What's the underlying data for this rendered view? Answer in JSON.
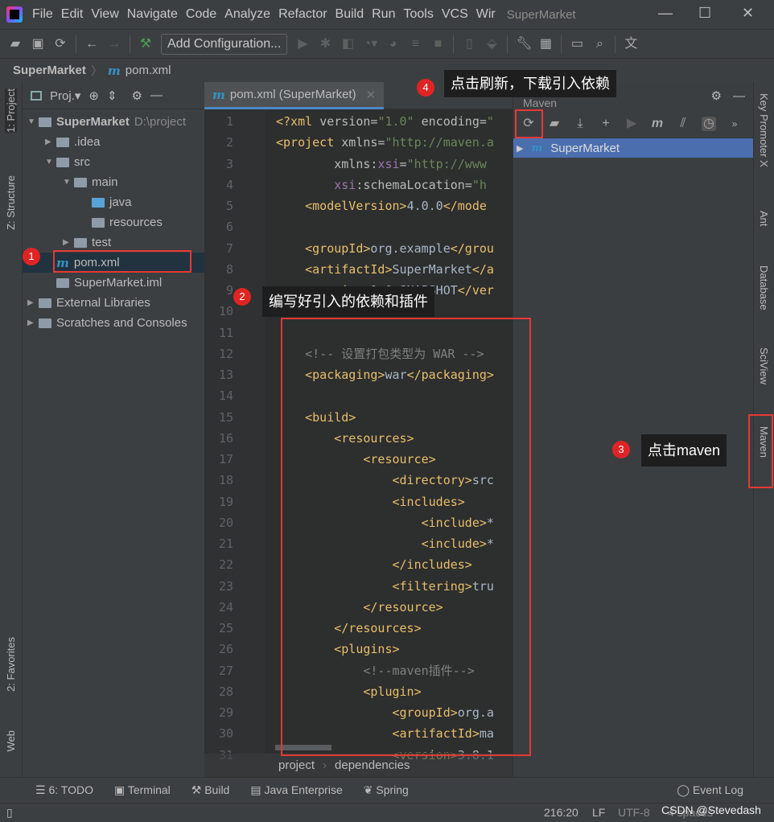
{
  "window": {
    "title": "SuperMarket",
    "menu": [
      "File",
      "Edit",
      "View",
      "Navigate",
      "Code",
      "Analyze",
      "Refactor",
      "Build",
      "Run",
      "Tools",
      "VCS",
      "Wir"
    ]
  },
  "toolbar": {
    "add_configuration": "Add Configuration..."
  },
  "breadcrumb": {
    "project": "SuperMarket",
    "file": "pom.xml",
    "maven_glyph": "m"
  },
  "left_strip": {
    "project": "1: Project",
    "structure": "Z: Structure",
    "favorites": "2: Favorites",
    "web": "Web"
  },
  "project_panel": {
    "title": "Proj.▾",
    "tree": [
      {
        "label": "SuperMarket",
        "extra": "D:\\project",
        "level": 0,
        "caret": "▼",
        "icon": "module-folder"
      },
      {
        "label": ".idea",
        "level": 1,
        "caret": "▶",
        "icon": "folder"
      },
      {
        "label": "src",
        "level": 1,
        "caret": "▼",
        "icon": "folder"
      },
      {
        "label": "main",
        "level": 2,
        "caret": "▼",
        "icon": "folder"
      },
      {
        "label": "java",
        "level": 3,
        "caret": "",
        "icon": "source-folder"
      },
      {
        "label": "resources",
        "level": 3,
        "caret": "",
        "icon": "resources-folder"
      },
      {
        "label": "test",
        "level": 2,
        "caret": "▶",
        "icon": "folder"
      },
      {
        "label": "pom.xml",
        "level": 1,
        "caret": "",
        "icon": "maven-file"
      },
      {
        "label": "SuperMarket.iml",
        "level": 1,
        "caret": "",
        "icon": "iml-file"
      },
      {
        "label": "External Libraries",
        "level": 0,
        "caret": "▶",
        "icon": "libraries"
      },
      {
        "label": "Scratches and Consoles",
        "level": 0,
        "caret": "▶",
        "icon": "scratches"
      }
    ]
  },
  "editor": {
    "tab": "pom.xml (SuperMarket)",
    "lines": [
      [
        [
          "t",
          "<?xml "
        ],
        [
          "a",
          "version="
        ],
        [
          "v",
          "\"1.0\" "
        ],
        [
          "a",
          "encoding="
        ],
        [
          "v",
          "\""
        ]
      ],
      [
        [
          "t",
          "<project "
        ],
        [
          "a",
          "xmlns="
        ],
        [
          "v",
          "\"http://maven.a"
        ]
      ],
      [
        [
          "a",
          "        xmlns:"
        ],
        [
          "p",
          "xsi"
        ],
        [
          "a",
          "="
        ],
        [
          "v",
          "\"http://www"
        ]
      ],
      [
        [
          "p",
          "        xsi"
        ],
        [
          "a",
          ":schemaLocation="
        ],
        [
          "v",
          "\"h"
        ]
      ],
      [
        [
          "t",
          "    <modelVersion>"
        ],
        [
          "c",
          "4.0.0"
        ],
        [
          "t",
          "</mode"
        ]
      ],
      [],
      [
        [
          "t",
          "    <groupId>"
        ],
        [
          "c",
          "org.example"
        ],
        [
          "t",
          "</grou"
        ]
      ],
      [
        [
          "t",
          "    <artifactId>"
        ],
        [
          "c",
          "SuperMarket"
        ],
        [
          "t",
          "</a"
        ]
      ],
      [
        [
          "t",
          "    <version>"
        ],
        [
          "c",
          "1.0-SNAPSHOT"
        ],
        [
          "t",
          "</ver"
        ]
      ],
      [],
      [],
      [
        [
          "k",
          "    <!-- 设置打包类型为 WAR -->"
        ]
      ],
      [
        [
          "t",
          "    <packaging>"
        ],
        [
          "c",
          "war"
        ],
        [
          "t",
          "</packaging>"
        ]
      ],
      [],
      [
        [
          "t",
          "    <build>"
        ]
      ],
      [
        [
          "t",
          "        <resources>"
        ]
      ],
      [
        [
          "t",
          "            <resource>"
        ]
      ],
      [
        [
          "t",
          "                <directory>"
        ],
        [
          "c",
          "src"
        ]
      ],
      [
        [
          "t",
          "                <includes>"
        ]
      ],
      [
        [
          "t",
          "                    <include>"
        ],
        [
          "c",
          "*"
        ]
      ],
      [
        [
          "t",
          "                    <include>"
        ],
        [
          "c",
          "*"
        ]
      ],
      [
        [
          "t",
          "                </includes>"
        ]
      ],
      [
        [
          "t",
          "                <filtering>"
        ],
        [
          "c",
          "tru"
        ]
      ],
      [
        [
          "t",
          "            </resource>"
        ]
      ],
      [
        [
          "t",
          "        </resources>"
        ]
      ],
      [
        [
          "t",
          "        <plugins>"
        ]
      ],
      [
        [
          "k",
          "            <!--maven插件-->"
        ]
      ],
      [
        [
          "t",
          "            <plugin>"
        ]
      ],
      [
        [
          "t",
          "                <groupId>"
        ],
        [
          "c",
          "org.a"
        ]
      ],
      [
        [
          "t",
          "                <artifactId>"
        ],
        [
          "c",
          "ma"
        ]
      ],
      [
        [
          "t",
          "                <version>"
        ],
        [
          "c",
          "3.8.1"
        ]
      ]
    ],
    "crumbs": [
      "project",
      "dependencies"
    ]
  },
  "maven_panel": {
    "title": "Maven",
    "root": "SuperMarket"
  },
  "right_strip": {
    "key_promoter": "Key Promoter X",
    "ant": "Ant",
    "database": "Database",
    "sciview": "SciView",
    "maven": "Maven"
  },
  "tool_windows": [
    "6: TODO",
    "Terminal",
    "Build",
    "Java Enterprise",
    "Spring"
  ],
  "event_log": "Event Log",
  "status": {
    "position": "216:20",
    "line_sep": "LF",
    "encoding": "UTF-8",
    "indent": "4 spaces",
    "watermark": "CSDN @Stevedash"
  },
  "annotations": [
    {
      "n": "1",
      "text": ""
    },
    {
      "n": "2",
      "text": "编写好引入的依赖和插件"
    },
    {
      "n": "3",
      "text": "点击maven"
    },
    {
      "n": "4",
      "text": "点击刷新，下载引入依赖"
    }
  ],
  "colors": {
    "annotation_red": "#e53935",
    "selection": "#4b6eaf",
    "xml_tag": "#e8bf6a"
  }
}
